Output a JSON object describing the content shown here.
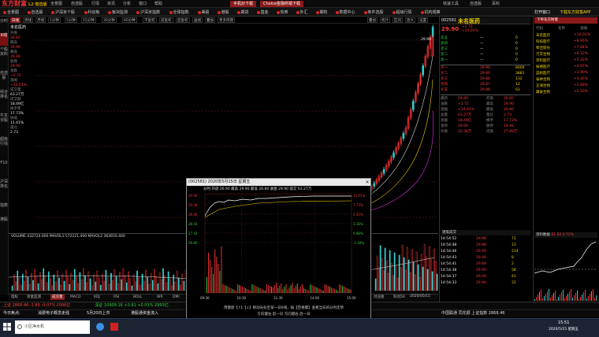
{
  "app": {
    "logo": "东方财富",
    "logo_sub": "L2·智选版"
  },
  "titlebar": {
    "items": [
      "全景图",
      "自选股",
      "行情",
      "资讯",
      "分析",
      "窗口",
      "帮助"
    ],
    "btn_mobile": "手机炒下载",
    "btn_choice": "Choice金融终端下载",
    "right_items": [
      "快速工具",
      "自选股",
      "百科"
    ]
  },
  "menubar": {
    "items": [
      "全景图",
      "自选股",
      "沪深京个股",
      "科创板",
      "板块监测",
      "沪深京指数",
      "全球指数",
      "美股",
      "港股",
      "期货",
      "基金",
      "债券",
      "外汇",
      "期权",
      "数据中心",
      "条件选股",
      "超级行情",
      "机构观察"
    ],
    "right": [
      "打开窗口",
      "下载东方财富APP"
    ]
  },
  "sidebar": {
    "tabs": [
      "分时",
      "K线",
      "个股资料",
      "自选股",
      "综合排名",
      "牛叉诊股",
      "超级行情",
      "F10",
      "沪深排名",
      "指数",
      "港股"
    ]
  },
  "toolbar": {
    "items": [
      "日线",
      "周线",
      "月线",
      "1分钟",
      "5分钟",
      "15分钟",
      "30分钟",
      "60分钟",
      "不复权",
      "前复权",
      "后复权",
      "画线",
      "叠加",
      "更多周期"
    ],
    "active_index": 0,
    "right": [
      "叠加",
      "统计",
      "区间",
      "放大",
      "设置"
    ]
  },
  "left_panel": {
    "stock_name": "未名医药",
    "labels": [
      "开盘",
      "最高",
      "最低",
      "收盘",
      "涨跌",
      "涨幅",
      "成交量",
      "成交额",
      "换手率",
      "振幅",
      "量比"
    ],
    "values": [
      "26.85",
      "29.90",
      "26.80",
      "29.90",
      "+2.72",
      "+10.01%",
      "63.27万",
      "18.49亿",
      "17.73%",
      "11.41%",
      "2.73"
    ]
  },
  "main_chart": {
    "price_high_label": "29.90",
    "ma_label": "MA5 MA10 MA20 MA60"
  },
  "volume_panel": {
    "label": "VOLUME 432724.000  MAVOL1 572221.400  MAVOL2 364650.400"
  },
  "bottom_tabs": {
    "items": [
      "指标",
      "资金监测",
      "成交量",
      "MACD",
      "KDJ",
      "RSI",
      "BOLL",
      "WR",
      "DMI",
      "BIAS",
      "CCI",
      "OBV",
      "SAR",
      "ROC",
      "TRIX",
      "更多指标",
      "上证",
      "深证",
      "创业板",
      "科创50"
    ],
    "active_index": 2,
    "date": "2020/05/15"
  },
  "status": {
    "line1": [
      "上证 2868.46 -1.88 -0.07% 2086亿",
      "深证 10908.16 +0.91 +0.01% 2993亿",
      "创业板 2143.32 +1.24 +0.06% 814亿",
      "科创50 1407.39 +4.38 +0.31%"
    ],
    "line2": [
      "今日焦点:",
      "消费电子概念走强",
      "5月20日上市",
      "港股通资金流入"
    ],
    "right": "中国联通  同花顺  上证指数 2868.46"
  },
  "right_panel": {
    "code": "002581",
    "name": "未名医药",
    "price": "29.90",
    "change": "+2.72",
    "pct": "+10.01%",
    "sell": [
      [
        "卖五",
        "—",
        "0"
      ],
      [
        "卖四",
        "—",
        "0"
      ],
      [
        "卖三",
        "—",
        "0"
      ],
      [
        "卖二",
        "—",
        "0"
      ],
      [
        "卖一",
        "—",
        "0"
      ]
    ],
    "buy": [
      [
        "买一",
        "29.90",
        "8000"
      ],
      [
        "买二",
        "29.89",
        "3881"
      ],
      [
        "买三",
        "29.88",
        "132"
      ],
      [
        "买四",
        "29.87",
        "12"
      ],
      [
        "买五",
        "29.86",
        "63"
      ]
    ],
    "stats": [
      [
        "最新",
        "29.90",
        "开盘",
        "26.85"
      ],
      [
        "涨跌",
        "+2.72",
        "最高",
        "29.90"
      ],
      [
        "涨幅",
        "+10.01%",
        "最低",
        "26.80"
      ],
      [
        "总量",
        "63.27万",
        "量比",
        "2.73"
      ],
      [
        "总额",
        "18.49亿",
        "换手",
        "17.73%"
      ],
      [
        "涨停",
        "29.90",
        "跌停",
        "24.46"
      ],
      [
        "外盘",
        "35.38万",
        "内盘",
        "27.89万"
      ]
    ],
    "trades": [
      [
        "14:54:52",
        "29.88",
        "71"
      ],
      [
        "14:54:48",
        "29.88",
        "13"
      ],
      [
        "14:54:46",
        "29.90",
        "214"
      ],
      [
        "14:54:43",
        "29.90",
        "8"
      ],
      [
        "14:54:41",
        "29.89",
        "2"
      ],
      [
        "14:54:38",
        "29.90",
        "58"
      ],
      [
        "14:54:37",
        "29.90",
        "41"
      ],
      [
        "14:54:33",
        "29.90",
        "31"
      ]
    ]
  },
  "right_panel2": {
    "title": "下单东方财富",
    "header": [
      "代码",
      "名称",
      "涨幅"
    ],
    "rows": [
      [
        "未名医药",
        "+10.01%"
      ],
      [
        "科技医疗",
        "+8.95%"
      ],
      [
        "和佳股份",
        "+7.84%"
      ],
      [
        "万孚生物",
        "+6.12%"
      ],
      [
        "英科医疗",
        "+5.22%"
      ],
      [
        "振德医疗",
        "+4.87%"
      ],
      [
        "蓝帆医疗",
        "+3.90%"
      ],
      [
        "泰林生物",
        "+3.45%"
      ],
      [
        "正海生物",
        "+2.68%"
      ],
      [
        "康泰生物",
        "+2.10%"
      ]
    ],
    "bottom_label": "资料数据",
    "quote": "61.02 0.72%"
  },
  "popup": {
    "title": "(002581) 2020年5月15日 星期五",
    "info": "分时 开盘 26.90  最高 29.90  最低 26.80  收盘 29.90  成交 63.27万",
    "y_labels": [
      "29.90",
      "29.28",
      "28.66",
      "28.04",
      "27.42",
      "26.80"
    ],
    "pct_labels": [
      "10.01%",
      "7.73%",
      "5.45%",
      "3.16%",
      "0.88%",
      "-1.40%"
    ],
    "x_labels": [
      "09:30",
      "10:30",
      "11:30",
      "14:00",
      "15:00"
    ],
    "hint": "用键盘【↑】【↓】移动光标至某一日K线，按【空格键】查看当日的分时走势",
    "hint2": "方向键左  前一日  方向键右  后一日"
  },
  "taskbar": {
    "time": "15:51",
    "date": "2020/5/15 星期五",
    "search": "小区净水机"
  },
  "colors": {
    "up": "#ff3b3b",
    "down": "#2ecc40",
    "accent": "#8a1a1a"
  }
}
